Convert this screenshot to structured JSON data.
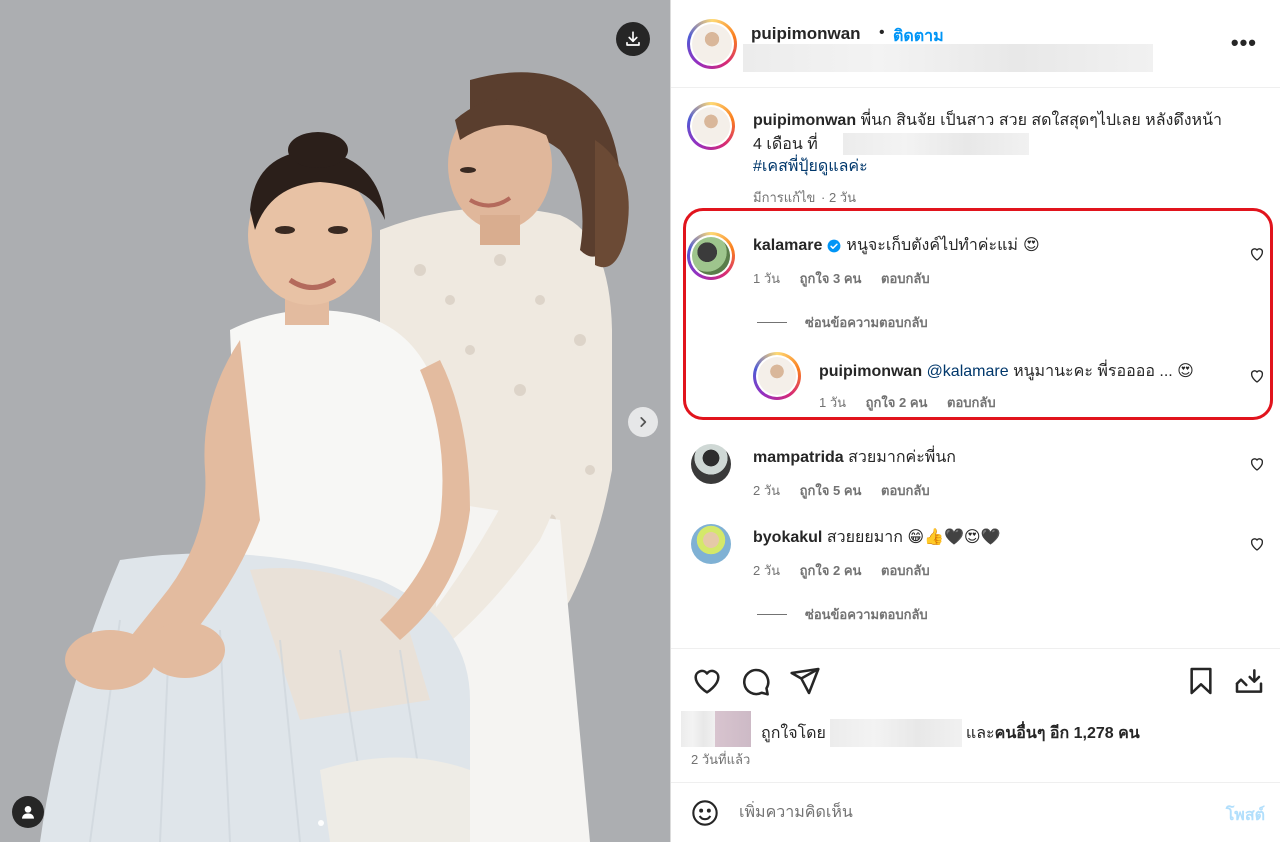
{
  "post": {
    "username": "puipimonwan",
    "separator": "•",
    "follow_label": "ติดตาม",
    "more_label": "•••"
  },
  "caption": {
    "username": "puipimonwan",
    "text_line1": "พี่นก สินจัย เป็นสาว สวย สดใสสุดๆไปเลย หลังดึงหน้า",
    "text_line2": "4 เดือน ที่",
    "hashtag": "#เคสพี่ปุ้ยดูแลค่ะ",
    "edited": "มีการแก้ไข",
    "time": "2 วัน"
  },
  "comments": [
    {
      "username": "kalamare",
      "verified": true,
      "text": "หนูจะเก็บตังค์ไปทำค่ะแม่",
      "emoji": "😍",
      "time": "1 วัน",
      "likes": "ถูกใจ 3 คน",
      "reply_label": "ตอบกลับ",
      "hide_replies": "ซ่อนข้อความตอบกลับ",
      "reply": {
        "username": "puipimonwan",
        "mention": "@kalamare",
        "text": "หนูมานะคะ พี่รออออ ...",
        "emoji": "😍",
        "time": "1 วัน",
        "likes": "ถูกใจ 2 คน",
        "reply_label": "ตอบกลับ"
      }
    },
    {
      "username": "mampatrida",
      "text": "สวยมากค่ะพี่นก",
      "time": "2 วัน",
      "likes": "ถูกใจ 5 คน",
      "reply_label": "ตอบกลับ"
    },
    {
      "username": "byokakul",
      "text": "สวยยยมาก",
      "emoji": "😁👍🖤😍🖤",
      "time": "2 วัน",
      "likes": "ถูกใจ 2 คน",
      "reply_label": "ตอบกลับ",
      "hide_replies": "ซ่อนข้อความตอบกลับ"
    }
  ],
  "actions": {
    "icons": [
      "heart-icon",
      "comment-icon",
      "share-icon",
      "bookmark-icon",
      "save-download-icon"
    ],
    "liked_by_prefix": "ถูกใจโดย",
    "liked_by_suffix": "และ",
    "others_text": "คนอื่นๆ อีก 1,278 คน",
    "time_ago": "2 วันที่แล้ว"
  },
  "comment_input": {
    "placeholder": "เพิ่มความคิดเห็น",
    "post_label": "โพสต์"
  },
  "colors": {
    "accent": "#0095f6",
    "highlight_border": "#e1141d",
    "hashtag": "#00376b",
    "muted": "#737373"
  }
}
